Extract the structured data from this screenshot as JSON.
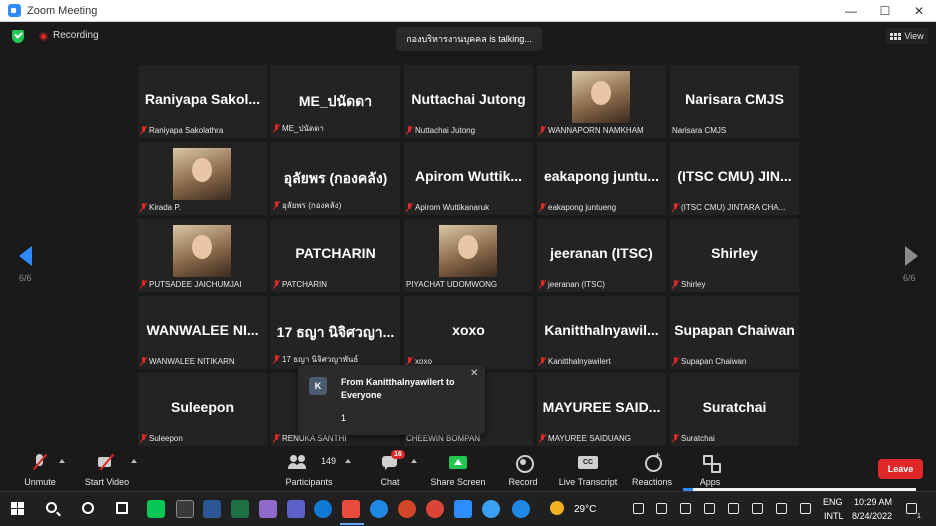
{
  "window": {
    "title": "Zoom Meeting",
    "minimize": "—",
    "maximize": "☐",
    "close": "✕"
  },
  "topbar": {
    "recording_label": "Recording",
    "talking": "กองบริหารงานบุคคล is talking...",
    "view_label": "View"
  },
  "pagination": {
    "left": "6/6",
    "right": "6/6"
  },
  "tiles": [
    {
      "big": "Raniyapa Sakol...",
      "name": "Raniyapa Sakolathra",
      "muted": true,
      "photo": false
    },
    {
      "big": "ME_ปนัดดา",
      "name": "ME_ปนัดดา",
      "muted": true,
      "photo": false
    },
    {
      "big": "Nuttachai Jutong",
      "name": "Nuttachai Jutong",
      "muted": true,
      "photo": false
    },
    {
      "big": "",
      "name": "WANNAPORN NAMKHAM",
      "muted": true,
      "photo": true
    },
    {
      "big": "Narisara CMJS",
      "name": "Narisara CMJS",
      "muted": false,
      "photo": false
    },
    {
      "big": "",
      "name": "Kirada P.",
      "muted": true,
      "photo": true
    },
    {
      "big": "อุลัยพร (กองคลัง)",
      "name": "อุลัยพร (กองคลัง)",
      "muted": true,
      "photo": false
    },
    {
      "big": "Apirom Wuttik...",
      "name": "Apirom Wuttikanaruk",
      "muted": true,
      "photo": false
    },
    {
      "big": "eakapong juntu...",
      "name": "eakapong juntueng",
      "muted": true,
      "photo": false
    },
    {
      "big": "(ITSC CMU) JIN...",
      "name": "(ITSC CMU) JINTARA CHA...",
      "muted": true,
      "photo": false
    },
    {
      "big": "",
      "name": "PUTSADEE JAICHUMJAI",
      "muted": true,
      "photo": true
    },
    {
      "big": "PATCHARIN",
      "name": "PATCHARIN",
      "muted": true,
      "photo": false
    },
    {
      "big": "",
      "name": "PIYACHAT UDOMWONG",
      "muted": false,
      "photo": true
    },
    {
      "big": "jeeranan (ITSC)",
      "name": "jeeranan (ITSC)",
      "muted": true,
      "photo": false
    },
    {
      "big": "Shirley",
      "name": "Shirley",
      "muted": true,
      "photo": false
    },
    {
      "big": "WANWALEE NI...",
      "name": "WANWALEE NITIKARN",
      "muted": true,
      "photo": false
    },
    {
      "big": "17 ธญา นิจิศวญา...",
      "name": "17 ธญา นิจิศวญาพันธ์",
      "muted": true,
      "photo": false
    },
    {
      "big": "xoxo",
      "name": "xoxo",
      "muted": true,
      "photo": false
    },
    {
      "big": "Kanitthalnyawil...",
      "name": "Kanitthalnyawilert",
      "muted": true,
      "photo": false
    },
    {
      "big": "Supapan Chaiwan",
      "name": "Supapan Chaiwan",
      "muted": true,
      "photo": false
    },
    {
      "big": "Suleepon",
      "name": "Suleepon",
      "muted": true,
      "photo": false
    },
    {
      "big": "",
      "name": "RENUKA SANTHI",
      "muted": true,
      "photo": false
    },
    {
      "big": "",
      "name": "CHEEWIN BOMPAN",
      "muted": false,
      "photo": false
    },
    {
      "big": "MAYUREE SAID...",
      "name": "MAYUREE SAIDUANG",
      "muted": true,
      "photo": false
    },
    {
      "big": "Suratchai",
      "name": "Suratchai",
      "muted": true,
      "photo": false
    }
  ],
  "chat_popup": {
    "avatar_letter": "K",
    "from": "From Kanitthalnyawilert to Everyone",
    "message": "1",
    "close": "✕"
  },
  "toolbar": {
    "unmute": "Unmute",
    "start_video": "Start Video",
    "participants_count": "149",
    "participants": "Participants",
    "chat_badge": "16",
    "chat": "Chat",
    "share_screen": "Share Screen",
    "record": "Record",
    "live_transcript": "Live Transcript",
    "reactions": "Reactions",
    "apps": "Apps",
    "leave": "Leave"
  },
  "taskbar": {
    "weather_temp": "29°C",
    "lang_top": "ENG",
    "lang_bottom": "INTL",
    "time": "10:29 AM",
    "date": "8/24/2022",
    "notification_count": "1"
  },
  "colors": {
    "accent": "#2d8cff",
    "muted": "#e02828",
    "share": "#23c552",
    "leave": "#e02828"
  }
}
